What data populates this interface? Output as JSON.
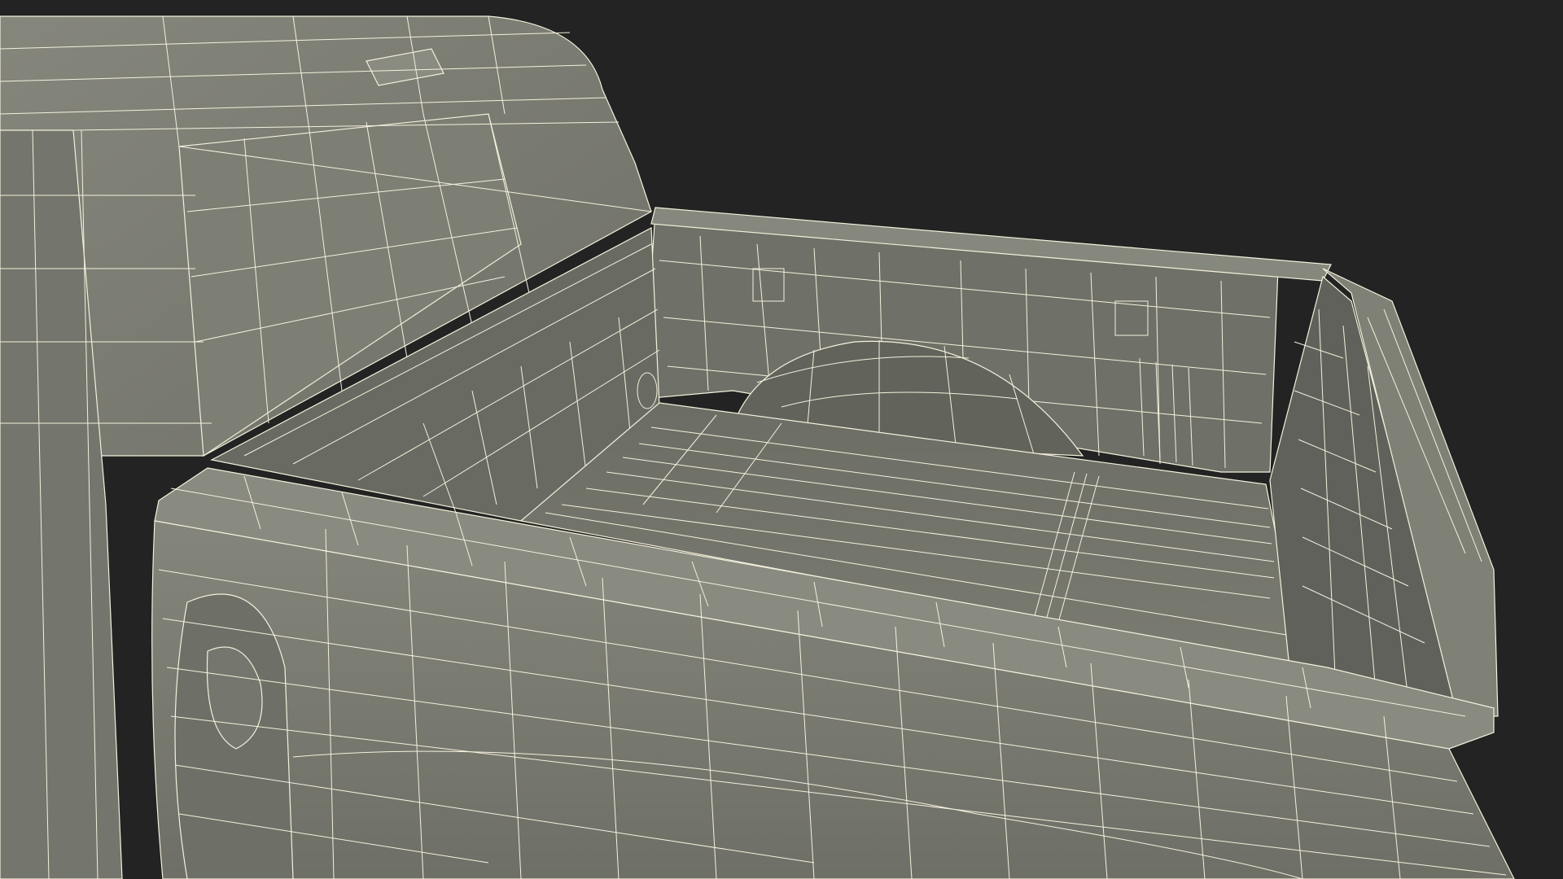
{
  "viewport": {
    "background_color": "#232323",
    "mesh_fill_color": "#7b7c72",
    "mesh_shade_color": "#6a6b62",
    "mesh_dark_color": "#5c5d55",
    "wireframe_color": "#f4f1dc"
  },
  "scene": {
    "subject": "pickup-truck-bed-wireframe-model"
  }
}
